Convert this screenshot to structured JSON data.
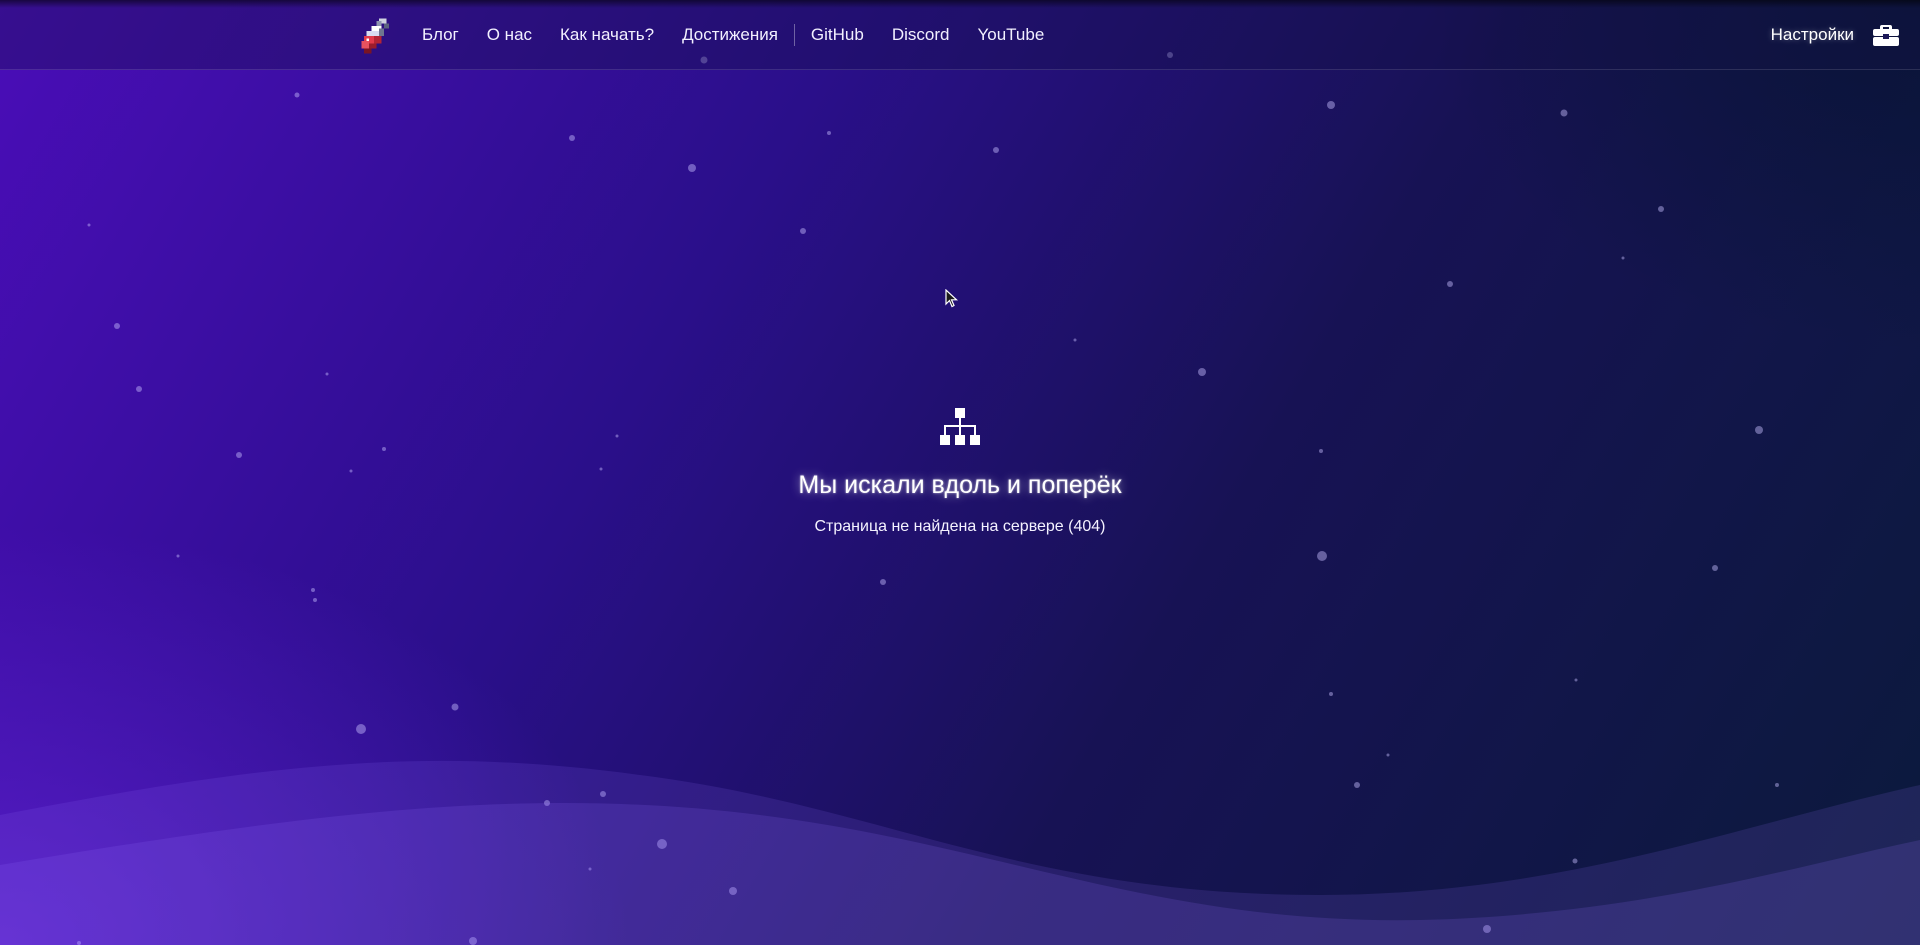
{
  "nav": {
    "logo_icon": "potion-bottle-icon",
    "items": [
      {
        "label": "Блог"
      },
      {
        "label": "О нас"
      },
      {
        "label": "Как начать?"
      },
      {
        "label": "Достижения"
      },
      {
        "label": "GitHub"
      },
      {
        "label": "Discord"
      },
      {
        "label": "YouTube"
      }
    ]
  },
  "settings": {
    "label": "Настройки",
    "icon": "toolbox-icon"
  },
  "error": {
    "icon": "sitemap-icon",
    "title": "Мы искали вдоль и поперёк",
    "subtitle": "Страница не найдена на сервере (404)"
  },
  "colors": {
    "bg_left": "#4a0db8",
    "bg_mid": "#171254",
    "bg_right": "#0b1a3c",
    "text": "#ffffff"
  }
}
